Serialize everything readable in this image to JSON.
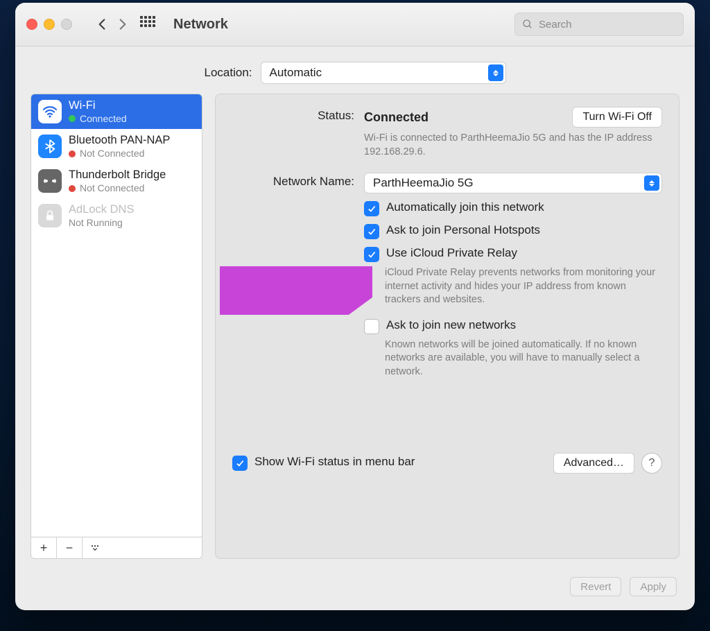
{
  "window_title": "Network",
  "search_placeholder": "Search",
  "location": {
    "label": "Location:",
    "value": "Automatic"
  },
  "services": [
    {
      "name": "Wi-Fi",
      "status": "Connected",
      "dot": "green"
    },
    {
      "name": "Bluetooth PAN-NAP",
      "status": "Not Connected",
      "dot": "red"
    },
    {
      "name": "Thunderbolt Bridge",
      "status": "Not Connected",
      "dot": "red"
    },
    {
      "name": "AdLock DNS",
      "status": "Not Running",
      "dot": ""
    }
  ],
  "detail": {
    "status_label": "Status:",
    "status_value": "Connected",
    "wifi_off_btn": "Turn Wi-Fi Off",
    "status_desc": "Wi-Fi is connected to ParthHeemaJio 5G and has the IP address 192.168.29.6.",
    "network_name_label": "Network Name:",
    "network_name_value": "ParthHeemaJio 5G",
    "auto_join": "Automatically join this network",
    "ask_hotspots": "Ask to join Personal Hotspots",
    "use_relay": "Use iCloud Private Relay",
    "relay_desc": "iCloud Private Relay prevents networks from monitoring your internet activity and hides your IP address from known trackers and websites.",
    "ask_new": "Ask to join new networks",
    "ask_new_desc": "Known networks will be joined automatically. If no known networks are available, you will have to manually select a network.",
    "show_menu": "Show Wi-Fi status in menu bar",
    "advanced": "Advanced…",
    "revert": "Revert",
    "apply": "Apply"
  }
}
